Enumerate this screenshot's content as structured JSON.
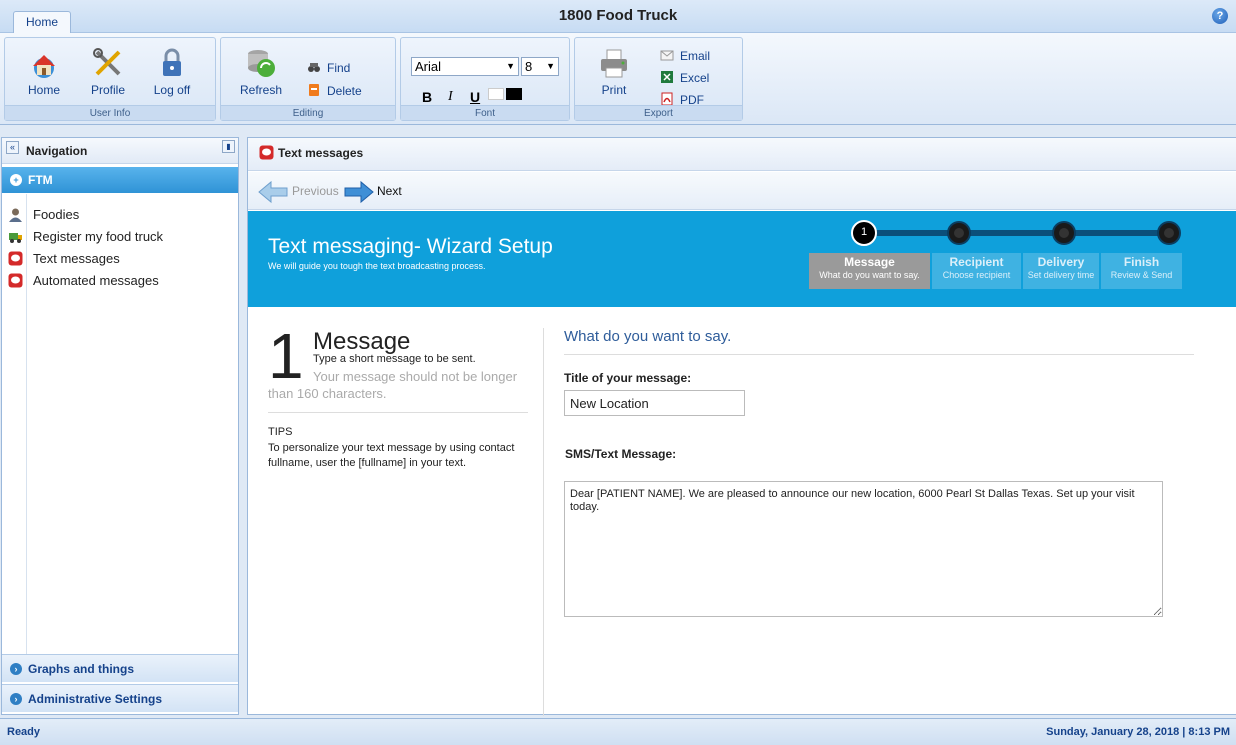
{
  "app": {
    "title": "1800 Food Truck",
    "home_tab": "Home",
    "help_icon": "?"
  },
  "ribbon": {
    "user_info": {
      "label": "User Info",
      "home": "Home",
      "profile": "Profile",
      "logoff": "Log off"
    },
    "editing": {
      "label": "Editing",
      "refresh": "Refresh",
      "find": "Find",
      "delete": "Delete"
    },
    "font": {
      "label": "Font",
      "family": "Arial",
      "size": "8",
      "bold": "B",
      "italic": "I",
      "underline": "U"
    },
    "export": {
      "label": "Export",
      "print": "Print",
      "email": "Email",
      "excel": "Excel",
      "pdf": "PDF"
    }
  },
  "navigation": {
    "title": "Navigation",
    "collapse_icon": "«",
    "section_ftm": "FTM",
    "items": [
      {
        "label": "Foodies",
        "icon": "foodies-icon"
      },
      {
        "label": "Register my food truck",
        "icon": "truck-icon"
      },
      {
        "label": "Text messages",
        "icon": "sms-icon"
      },
      {
        "label": "Automated messages",
        "icon": "sms-icon"
      }
    ],
    "section_graphs": "Graphs and things",
    "section_admin": "Administrative Settings"
  },
  "main": {
    "title": "Text messages",
    "previous": "Previous",
    "next": "Next"
  },
  "wizard": {
    "title": "Text messaging- Wizard Setup",
    "subtitle": "We will guide you tough the text broadcasting process.",
    "active_step_number": "1",
    "steps": [
      {
        "title": "Message",
        "subtitle": "What do you want to say."
      },
      {
        "title": "Recipient",
        "subtitle": "Choose recipient"
      },
      {
        "title": "Delivery",
        "subtitle": "Set delivery time"
      },
      {
        "title": "Finish",
        "subtitle": "Review & Send"
      }
    ]
  },
  "step_panel": {
    "number": "1",
    "title": "Message",
    "description": "Type a short message to be sent.",
    "note": "Your message should not be longer than 160 characters.",
    "tips_label": "TIPS",
    "tips_text": "To personalize your text message by using contact fullname, user the [fullname] in your text."
  },
  "form": {
    "heading": "What do you want to say.",
    "title_label": "Title of your message:",
    "title_value": "New Location",
    "sms_label": "SMS/Text Message:",
    "sms_value": "Dear [PATIENT NAME]. We are pleased to announce our new location, 6000 Pearl St Dallas Texas. Set up your visit today."
  },
  "status": {
    "text": "Ready",
    "datetime": "Sunday, January 28, 2018 | 8:13 PM"
  },
  "colors": {
    "banner": "#0fa0db",
    "accent": "#15428b",
    "nav_active": "#2f93d6"
  }
}
